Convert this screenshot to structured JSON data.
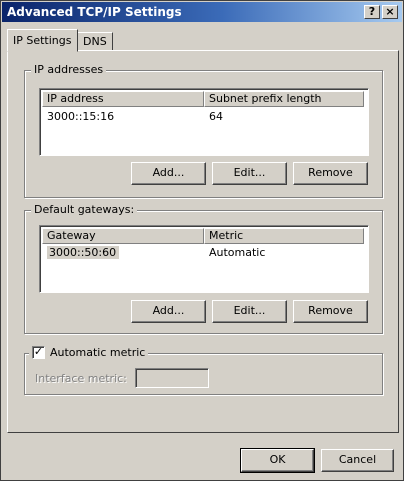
{
  "window": {
    "title": "Advanced TCP/IP Settings",
    "help_glyph": "?",
    "close_glyph": "×"
  },
  "tabs": [
    {
      "label": "IP Settings",
      "active": true
    },
    {
      "label": "DNS",
      "active": false
    }
  ],
  "ip_addresses": {
    "group_label": "IP addresses",
    "columns": [
      "IP address",
      "Subnet prefix length"
    ],
    "rows": [
      {
        "address": "3000::15:16",
        "prefix": "64"
      }
    ],
    "buttons": {
      "add": "Add...",
      "edit": "Edit...",
      "remove": "Remove"
    }
  },
  "default_gateways": {
    "group_label": "Default gateways:",
    "columns": [
      "Gateway",
      "Metric"
    ],
    "rows": [
      {
        "gateway": "3000::50:60",
        "metric": "Automatic"
      }
    ],
    "buttons": {
      "add": "Add...",
      "edit": "Edit...",
      "remove": "Remove"
    }
  },
  "automatic_metric": {
    "label": "Automatic metric",
    "checked": true,
    "check_glyph": "✓",
    "interface_metric_label": "Interface metric:",
    "interface_metric_value": ""
  },
  "footer": {
    "ok": "OK",
    "cancel": "Cancel"
  }
}
